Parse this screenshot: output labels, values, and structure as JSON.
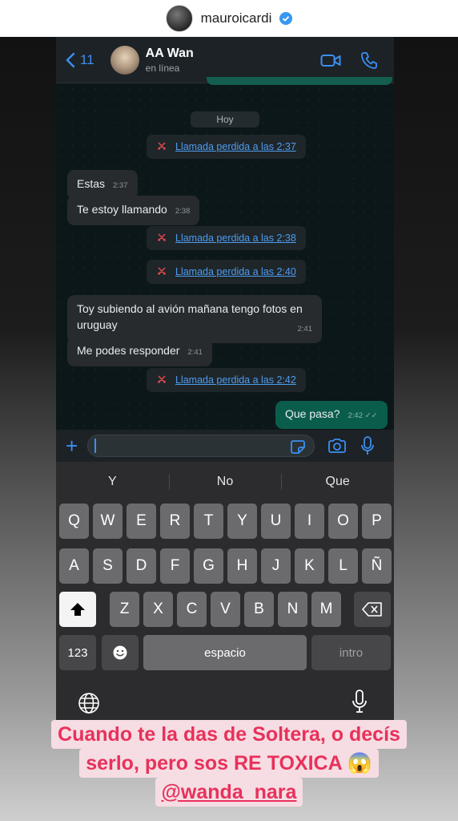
{
  "story": {
    "username": "mauroicardi"
  },
  "chat_header": {
    "back_count": "11",
    "contact_name": "AA Wan",
    "contact_status": "en línea"
  },
  "chat": {
    "date_label": "Hoy",
    "messages": [
      {
        "type": "missed",
        "text": "Llamada perdida a las 2:37"
      },
      {
        "type": "in",
        "text": "Estas",
        "time": "2:37"
      },
      {
        "type": "in",
        "text": "Te estoy llamando",
        "time": "2:38"
      },
      {
        "type": "missed",
        "text": "Llamada perdida a las 2:38"
      },
      {
        "type": "missed",
        "text": "Llamada perdida a las 2:40"
      },
      {
        "type": "in",
        "text": "Toy subiendo al avión mañana tengo fotos en uruguay",
        "time": "2:41"
      },
      {
        "type": "in",
        "text": "Me podes responder",
        "time": "2:41"
      },
      {
        "type": "missed",
        "text": "Llamada perdida a las 2:42"
      },
      {
        "type": "out",
        "text": "Que pasa?",
        "time": "2:42"
      }
    ]
  },
  "keyboard": {
    "suggestions": [
      "Y",
      "No",
      "Que"
    ],
    "row1": [
      "Q",
      "W",
      "E",
      "R",
      "T",
      "Y",
      "U",
      "I",
      "O",
      "P"
    ],
    "row2": [
      "A",
      "S",
      "D",
      "F",
      "G",
      "H",
      "J",
      "K",
      "L",
      "Ñ"
    ],
    "row3": [
      "Z",
      "X",
      "C",
      "V",
      "B",
      "N",
      "M"
    ],
    "numbers_label": "123",
    "space_label": "espacio",
    "return_label": "intro",
    "shift_icon": "shift-icon",
    "delete_icon": "delete-icon",
    "emoji_icon": "emoji-icon"
  },
  "caption": {
    "line1": "Cuando te la das de Soltera, o decís",
    "line2": "serlo, pero sos RE TOXICA 😱",
    "mention": "@wanda_nara"
  },
  "colors": {
    "accent": "#3b8ff3",
    "caption_text": "#e8315b",
    "caption_bg": "#f6dde3",
    "outgoing_bubble": "#0b5d4b",
    "missed_call_icon": "#e5484d"
  }
}
